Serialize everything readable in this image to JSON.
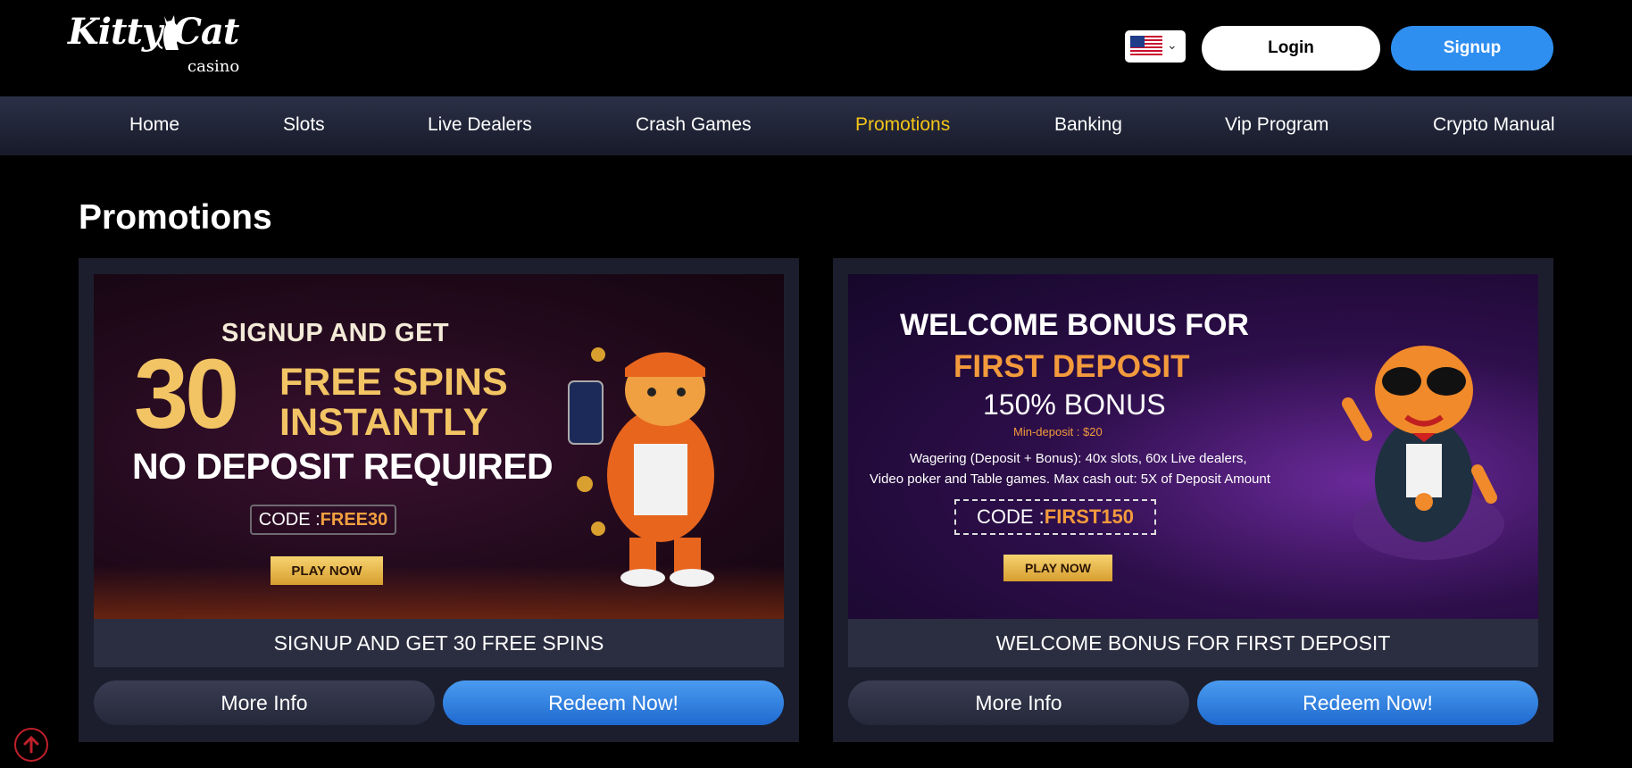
{
  "header": {
    "logo_text": "Kitty Cat",
    "logo_sub": "casino",
    "language": "us-flag-icon",
    "login_label": "Login",
    "signup_label": "Signup"
  },
  "nav": {
    "items": [
      "Home",
      "Slots",
      "Live Dealers",
      "Crash Games",
      "Promotions",
      "Banking",
      "Vip Program",
      "Crypto Manual"
    ],
    "active": "Promotions",
    "active_color": "#f5c518"
  },
  "page": {
    "title": "Promotions"
  },
  "promos": [
    {
      "banner": {
        "line1": "SIGNUP AND GET",
        "number": "30",
        "line2": "FREE SPINS",
        "line3": "INSTANTLY",
        "line4": "NO DEPOSIT REQUIRED",
        "code_label": "CODE : ",
        "code_value": "FREE30",
        "play": "PLAY NOW"
      },
      "caption": "SIGNUP AND GET 30 FREE SPINS",
      "more_label": "More Info",
      "redeem_label": "Redeem Now!"
    },
    {
      "banner": {
        "line1": "WELCOME BONUS FOR",
        "line2": "FIRST DEPOSIT",
        "line3": "150% BONUS",
        "line4": "Min-deposit : $20",
        "line5": "Wagering (Deposit + Bonus): 40x slots, 60x Live dealers,",
        "line6": "Video poker and Table games. Max cash out: 5X of Deposit Amount",
        "code_label": "CODE : ",
        "code_value": "FIRST150",
        "play": "PLAY NOW"
      },
      "caption": "WELCOME BONUS FOR FIRST DEPOSIT",
      "more_label": "More Info",
      "redeem_label": "Redeem Now!"
    }
  ],
  "colors": {
    "accent": "#2f8ff0",
    "gold": "#f2c464",
    "orange": "#f39a3c"
  }
}
